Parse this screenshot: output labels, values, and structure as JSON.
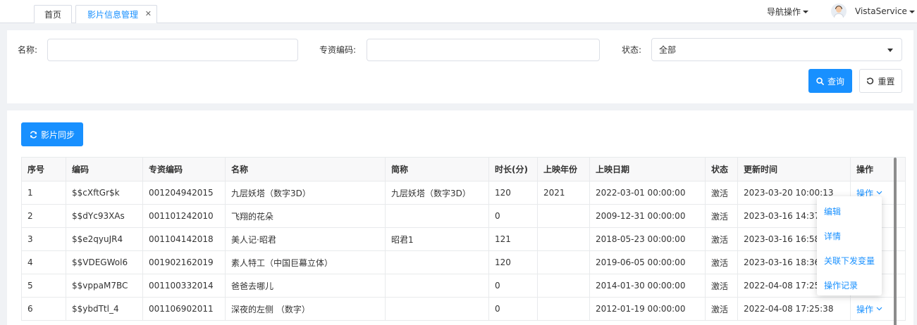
{
  "tabs": {
    "home": "首页",
    "active": "影片信息管理",
    "close_glyph": "✕"
  },
  "header": {
    "nav_menu": "导航操作",
    "username": "VistaService"
  },
  "search": {
    "name_label": "名称:",
    "name_value": "",
    "code_label": "专资编码:",
    "code_value": "",
    "status_label": "状态:",
    "status_selected": "全部",
    "query_button": "查询",
    "reset_button": "重置"
  },
  "toolbar": {
    "sync_button": "影片同步"
  },
  "table": {
    "columns": [
      "序号",
      "编码",
      "专资编码",
      "名称",
      "简称",
      "时长(分)",
      "上映年份",
      "上映日期",
      "状态",
      "更新时间",
      "操作"
    ],
    "rows": [
      [
        "1",
        "$$cXftGr$k",
        "001204942015",
        "九层妖塔（数字3D）",
        "九层妖塔（数字3D）",
        "120",
        "2021",
        "2022-03-01 00:00:00",
        "激活",
        "2023-03-20 10:00:13",
        "操作"
      ],
      [
        "2",
        "$$dYc93XAs",
        "001101242010",
        "飞翔的花朵",
        "",
        "0",
        "",
        "2009-12-31 00:00:00",
        "激活",
        "2023-03-16 14:37",
        ""
      ],
      [
        "3",
        "$$e2qyuJR4",
        "001104142018",
        "美人记·昭君",
        "昭君1",
        "121",
        "",
        "2018-05-23 00:00:00",
        "激活",
        "2023-03-16 16:58",
        ""
      ],
      [
        "4",
        "$$VDEGWol6",
        "001902162019",
        "素人特工（中国巨幕立体）",
        "",
        "120",
        "",
        "2019-06-05 00:00:00",
        "激活",
        "2023-03-16 18:36",
        ""
      ],
      [
        "5",
        "$$vppaM7BC",
        "001100332014",
        "爸爸去哪儿",
        "",
        "0",
        "",
        "2014-01-30 00:00:00",
        "激活",
        "2022-04-08 17:25",
        ""
      ],
      [
        "6",
        "$$ybdTtl_4",
        "001106902011",
        "深夜的左侧 （数字）",
        "",
        "0",
        "",
        "2012-01-19 00:00:00",
        "激活",
        "2022-04-08 17:25:38",
        "操作"
      ]
    ]
  },
  "dropdown": {
    "items": [
      "编辑",
      "详情",
      "关联下发变量",
      "操作记录"
    ]
  },
  "colors": {
    "primary": "#1890ff",
    "border": "#dcdfe6",
    "background": "#f0f2f5"
  }
}
